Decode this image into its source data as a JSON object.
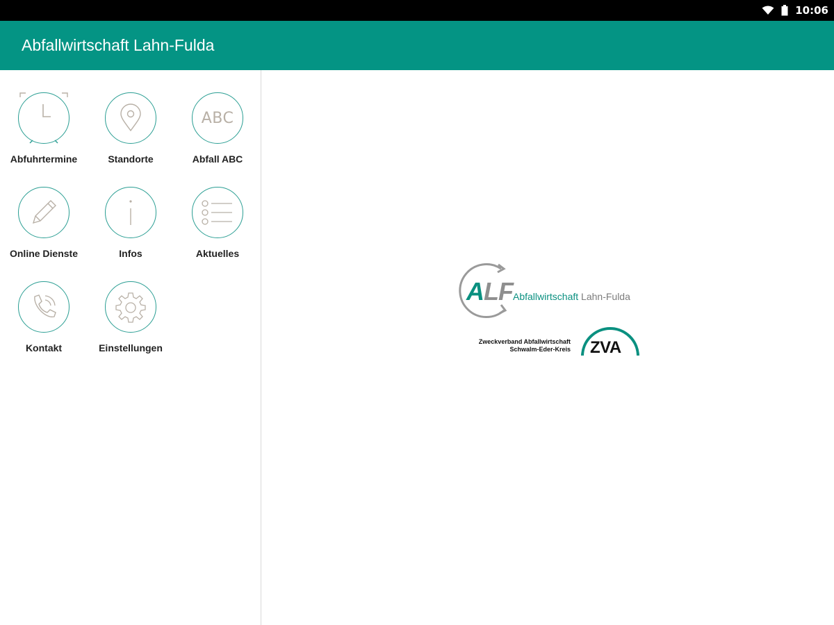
{
  "status_bar": {
    "time": "10:06",
    "icons": [
      "wifi-icon",
      "battery-icon"
    ]
  },
  "app_bar": {
    "title": "Abfallwirtschaft Lahn-Fulda",
    "color": "#049484"
  },
  "menu": {
    "items": [
      {
        "id": "abfuhrtermine",
        "label": "Abfuhrtermine",
        "icon": "alarm-clock-icon"
      },
      {
        "id": "standorte",
        "label": "Standorte",
        "icon": "location-pin-icon"
      },
      {
        "id": "abfall-abc",
        "label": "Abfall ABC",
        "icon": "abc-icon",
        "icon_text": "ABC"
      },
      {
        "id": "online-dienste",
        "label": "Online Dienste",
        "icon": "pencil-icon"
      },
      {
        "id": "infos",
        "label": "Infos",
        "icon": "info-icon"
      },
      {
        "id": "aktuelles",
        "label": "Aktuelles",
        "icon": "list-icon"
      },
      {
        "id": "kontakt",
        "label": "Kontakt",
        "icon": "phone-icon"
      },
      {
        "id": "einstellungen",
        "label": "Einstellungen",
        "icon": "gear-icon"
      }
    ]
  },
  "logos": {
    "alf": {
      "letter_a": "A",
      "letters_lf": "LF",
      "name_part1": "Abfallwirtschaft",
      "name_part2": " Lahn-Fulda"
    },
    "zva": {
      "line1": "Zweckverband Abfallwirtschaft",
      "line2": "Schwalm-Eder-Kreis",
      "badge": "ZVA"
    }
  }
}
